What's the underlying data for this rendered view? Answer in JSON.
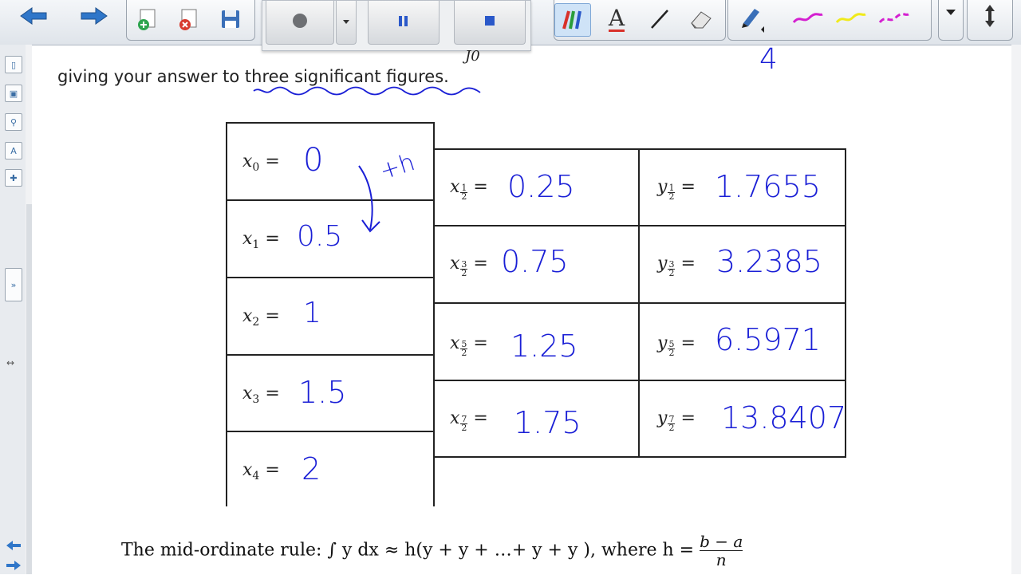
{
  "toolbar": {
    "icons": [
      "back-arrow-icon",
      "forward-arrow-icon",
      "add-page-icon",
      "delete-page-icon",
      "save-icon",
      "record-icon",
      "pause-icon",
      "stop-icon",
      "pens-icon",
      "text-icon",
      "line-icon",
      "eraser-icon",
      "pen-icon",
      "magenta-stroke-icon",
      "yellow-stroke-icon",
      "magenta-dash-icon",
      "dropdown-icon",
      "resize-icon"
    ],
    "text_tool_label": "A"
  },
  "page": {
    "question_fragment": "giving your answer to three significant figures.",
    "integral_limit_fragment": "J0",
    "handwritten_four": "4"
  },
  "table": {
    "left_column": [
      {
        "label_base": "x",
        "label_sub": "0",
        "value": "0"
      },
      {
        "label_base": "x",
        "label_sub": "1",
        "value": "0.5"
      },
      {
        "label_base": "x",
        "label_sub": "2",
        "value": "1"
      },
      {
        "label_base": "x",
        "label_sub": "3",
        "value": "1.5"
      },
      {
        "label_base": "x",
        "label_sub": "4",
        "value": "2"
      }
    ],
    "mid_column": [
      {
        "label_base": "x",
        "num": "1",
        "den": "2",
        "value": "0.25"
      },
      {
        "label_base": "x",
        "num": "3",
        "den": "2",
        "value": "0.75"
      },
      {
        "label_base": "x",
        "num": "5",
        "den": "2",
        "value": "1.25"
      },
      {
        "label_base": "x",
        "num": "7",
        "den": "2",
        "value": "1.75"
      }
    ],
    "right_column": [
      {
        "label_base": "y",
        "num": "1",
        "den": "2",
        "value": "1.7655"
      },
      {
        "label_base": "y",
        "num": "3",
        "den": "2",
        "value": "3.2385"
      },
      {
        "label_base": "y",
        "num": "5",
        "den": "2",
        "value": "6.5971"
      },
      {
        "label_base": "y",
        "num": "7",
        "den": "2",
        "value": "13.8407"
      }
    ],
    "annotation_h": "+h",
    "equals": "="
  },
  "formula": {
    "lead": "The mid-ordinate rule:",
    "body": "∫ y dx ≈ h(y + y + …+ y + y ), where h =",
    "h_num": "b − a",
    "h_den": "n"
  },
  "colors": {
    "ink": "#1a1fd6",
    "highlight": "#cfe3f7",
    "magenta": "#d41fd0",
    "yellow": "#f0ea1a"
  }
}
